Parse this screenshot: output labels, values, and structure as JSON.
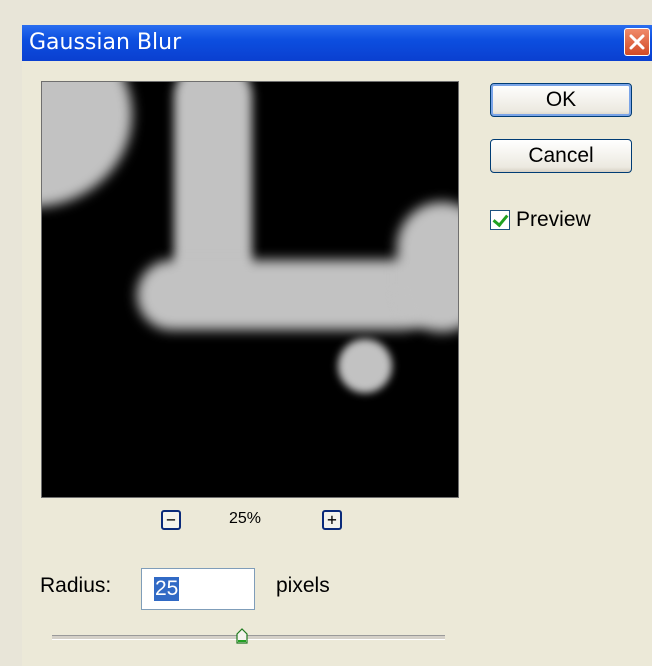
{
  "window": {
    "title": "Gaussian Blur"
  },
  "buttons": {
    "ok": "OK",
    "cancel": "Cancel"
  },
  "preview_option": {
    "label": "Preview",
    "checked": true
  },
  "zoom": {
    "level": "25%",
    "out_symbol": "−",
    "in_symbol": "+"
  },
  "radius": {
    "label": "Radius:",
    "value": "25",
    "unit": "pixels"
  },
  "slider": {
    "value_fraction": 0.5
  },
  "icons": {
    "close": "close-icon",
    "zoom_out": "zoom-out-icon",
    "zoom_in": "zoom-in-icon",
    "check": "checkmark-icon"
  },
  "colors": {
    "title_bar": "#0a46d8",
    "dialog_bg": "#ece9d8",
    "selection": "#316ac5",
    "check": "#21a121"
  }
}
